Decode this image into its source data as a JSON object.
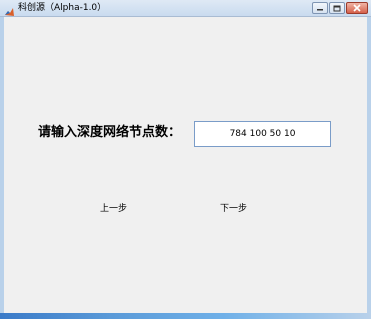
{
  "window": {
    "title": "科创源（Alpha-1.0）"
  },
  "form": {
    "prompt_label": "请输入深度网络节点数：",
    "node_input_value": "784 100 50 10"
  },
  "nav": {
    "prev_label": "上一步",
    "next_label": "下一步"
  }
}
